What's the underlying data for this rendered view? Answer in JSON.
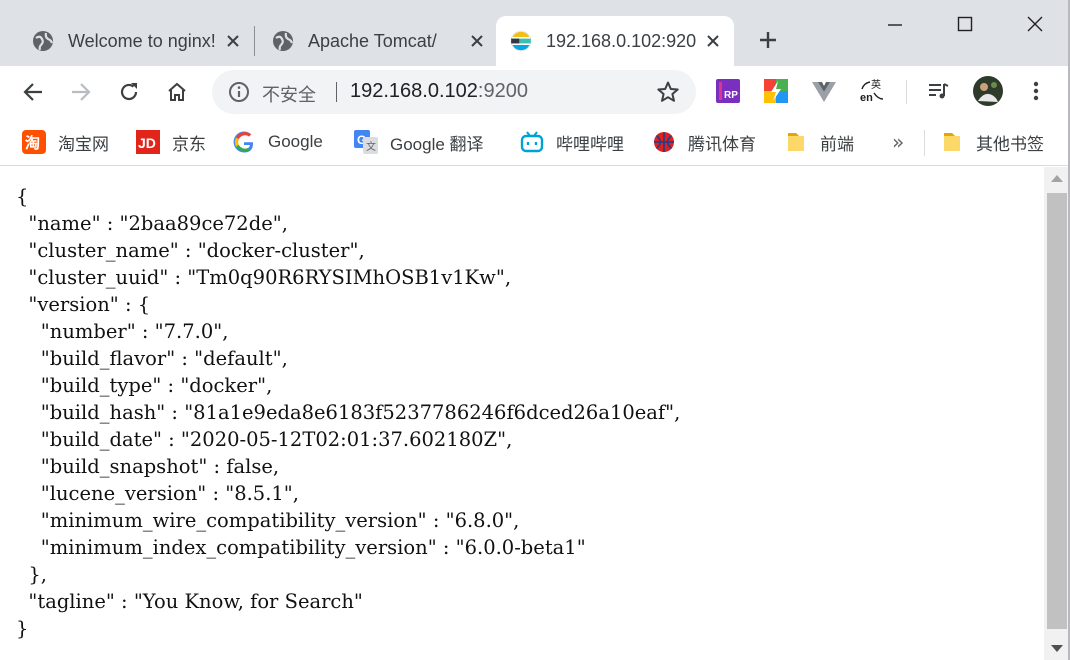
{
  "tabs": [
    {
      "title": "Welcome to nginx!",
      "favicon": "globe-icon",
      "active": false
    },
    {
      "title": "Apache Tomcat/",
      "favicon": "globe-icon",
      "active": false
    },
    {
      "title": "192.168.0.102:9200",
      "favicon": "elasticsearch-icon",
      "active": true
    }
  ],
  "address_bar": {
    "security_label": "不安全",
    "url_host": "192.168.0.102",
    "url_port": ":9200"
  },
  "extensions": [
    "rp-icon",
    "color-app-icon",
    "vue-devtools-icon",
    "translate-icon",
    "reading-list-icon",
    "profile-avatar-icon",
    "menu-icon"
  ],
  "bookmarks": [
    {
      "label": "淘宝网",
      "icon": "taobao-icon",
      "color": "#ff5000"
    },
    {
      "label": "京东",
      "icon": "jd-icon",
      "color": "#e1251b"
    },
    {
      "label": "Google",
      "icon": "google-icon",
      "color": "#4285f4"
    },
    {
      "label": "Google 翻译",
      "icon": "google-translate-icon",
      "color": "#4285f4"
    },
    {
      "label": "哔哩哔哩",
      "icon": "bilibili-icon",
      "color": "#00a1d6"
    },
    {
      "label": "腾讯体育",
      "icon": "tencent-sports-icon",
      "color": "#e02020"
    },
    {
      "label": "前端",
      "icon": "folder-icon",
      "color": "#f4c542"
    },
    {
      "label": "其他书签",
      "icon": "folder-icon",
      "color": "#f4c542"
    }
  ],
  "bookmarks_overflow": "»",
  "response_json": "{\n  \"name\" : \"2baa89ce72de\",\n  \"cluster_name\" : \"docker-cluster\",\n  \"cluster_uuid\" : \"Tm0q90R6RYSIMhOSB1v1Kw\",\n  \"version\" : {\n    \"number\" : \"7.7.0\",\n    \"build_flavor\" : \"default\",\n    \"build_type\" : \"docker\",\n    \"build_hash\" : \"81a1e9eda8e6183f5237786246f6dced26a10eaf\",\n    \"build_date\" : \"2020-05-12T02:01:37.602180Z\",\n    \"build_snapshot\" : false,\n    \"lucene_version\" : \"8.5.1\",\n    \"minimum_wire_compatibility_version\" : \"6.8.0\",\n    \"minimum_index_compatibility_version\" : \"6.0.0-beta1\"\n  },\n  \"tagline\" : \"You Know, for Search\"\n}"
}
